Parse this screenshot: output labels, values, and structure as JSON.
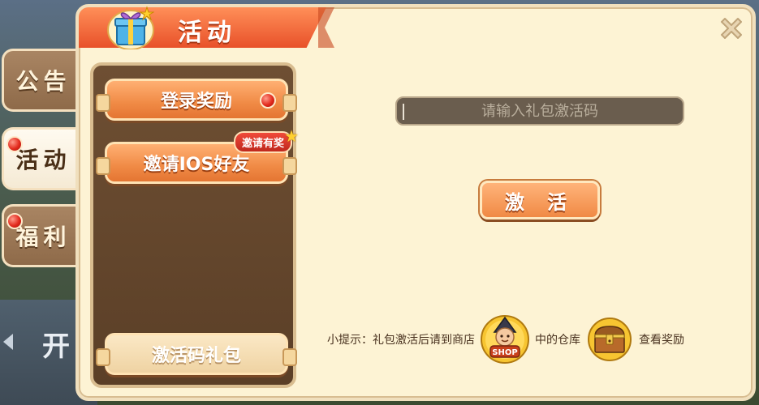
{
  "dialog": {
    "title": "活动"
  },
  "side_tabs": [
    {
      "label": "公告"
    },
    {
      "label": "活动"
    },
    {
      "label": "福利"
    }
  ],
  "background": {
    "start_text": "开"
  },
  "list": {
    "items": [
      {
        "label": "登录奖励"
      },
      {
        "label": "邀请IOS好友",
        "badge": "邀请有奖"
      },
      {
        "label": "激活码礼包"
      }
    ]
  },
  "activation": {
    "placeholder": "请输入礼包激活码",
    "button_label": "激 活"
  },
  "tip": {
    "prefix": "小提示：礼包激活后请到商店",
    "shop_label": "SHOP",
    "middle": "中的仓库",
    "suffix": "查看奖励"
  }
}
